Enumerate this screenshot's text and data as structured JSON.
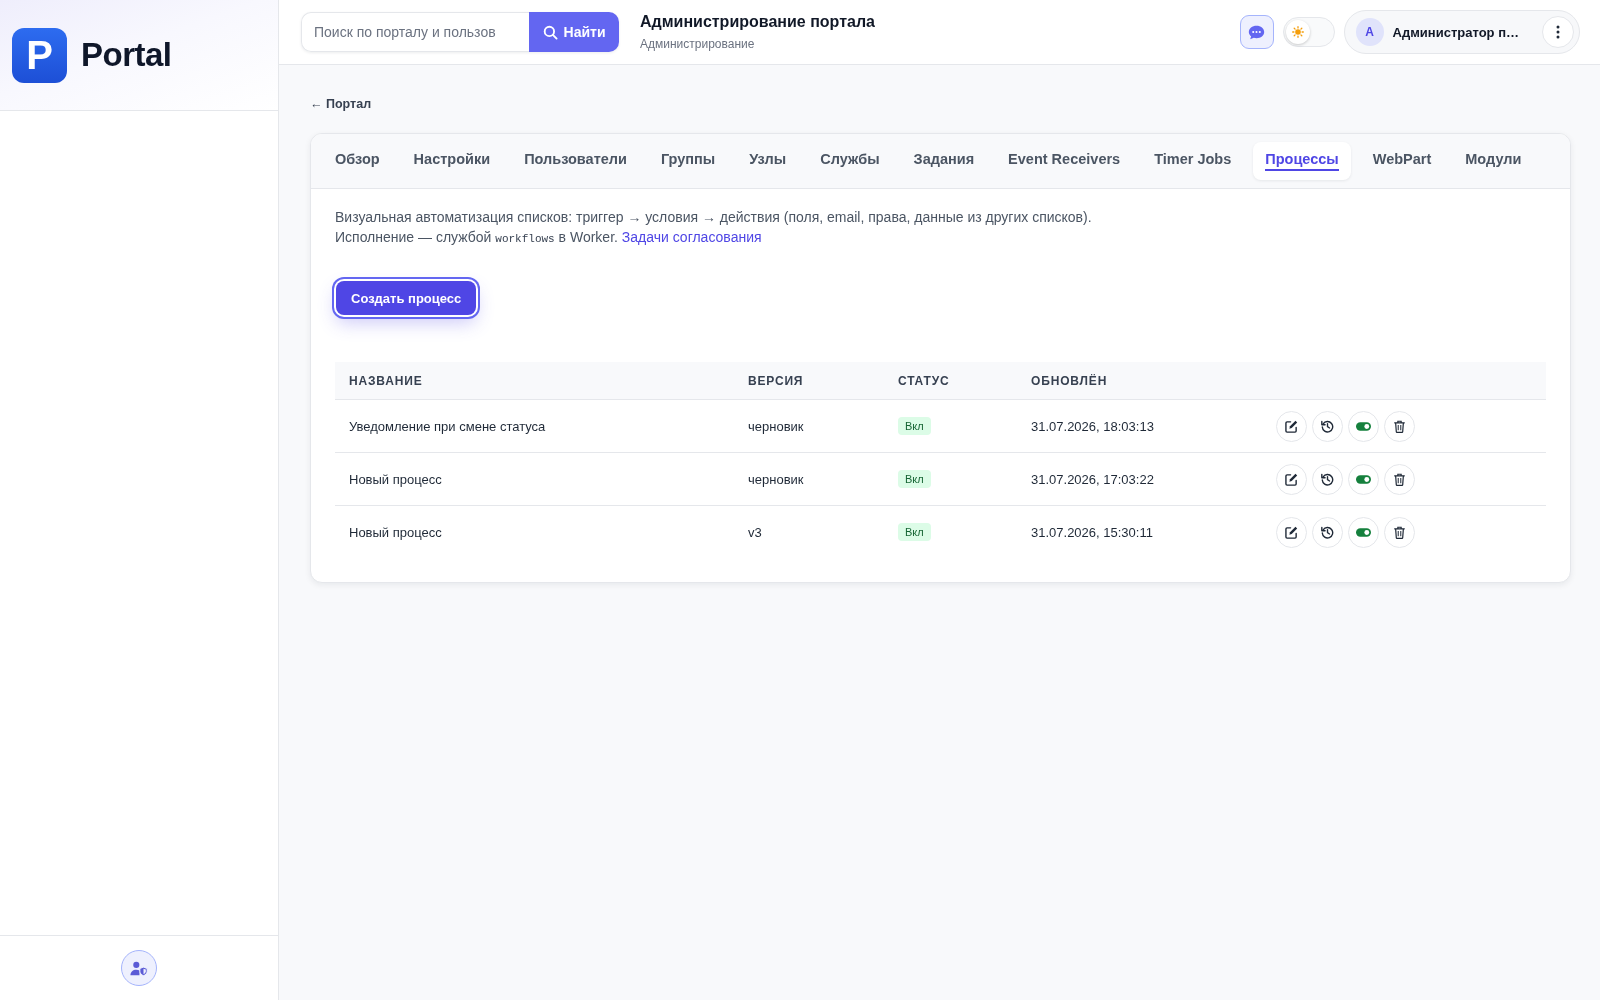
{
  "sidebar": {
    "logo_letter": "P",
    "brand": "Portal"
  },
  "topbar": {
    "search": {
      "placeholder": "Поиск по порталу и пользов",
      "button": "Найти"
    },
    "title": "Администрирование портала",
    "subtitle": "Администрирование",
    "theme_toggle": {
      "on": false
    },
    "user": {
      "initial": "A",
      "name": "Администратор п…"
    }
  },
  "back_link": "← Портал",
  "tabs": [
    {
      "label": "Обзор",
      "selected": false
    },
    {
      "label": "Настройки",
      "selected": false
    },
    {
      "label": "Пользователи",
      "selected": false
    },
    {
      "label": "Группы",
      "selected": false
    },
    {
      "label": "Узлы",
      "selected": false
    },
    {
      "label": "Службы",
      "selected": false
    },
    {
      "label": "Задания",
      "selected": false
    },
    {
      "label": "Event Receivers",
      "selected": false
    },
    {
      "label": "Timer Jobs",
      "selected": false
    },
    {
      "label": "Процессы",
      "selected": true
    },
    {
      "label": "WebPart",
      "selected": false
    },
    {
      "label": "Модули",
      "selected": false
    }
  ],
  "description": {
    "line_1": "Визуальная автоматизация списков: триггер → условия → действия (поля, email, права, данные из других списков).",
    "line_2_before": "Исполнение — службой",
    "line_2_code": "workflows",
    "line_2_after": "в Worker.",
    "link": "Задачи согласования"
  },
  "create_button": "Создать процесс",
  "table": {
    "columns": [
      "НАЗВАНИЕ",
      "ВЕРСИЯ",
      "СТАТУС",
      "ОБНОВЛЁН"
    ],
    "rows": [
      {
        "name": "Уведомление при смене статуса",
        "version": "черновик",
        "status": "Вкл",
        "enabled": true,
        "updated": "31.07.2026, 18:03:13"
      },
      {
        "name": "Новый процесс",
        "version": "черновик",
        "status": "Вкл",
        "enabled": true,
        "updated": "31.07.2026, 17:03:22"
      },
      {
        "name": "Новый процесс",
        "version": "v3",
        "status": "Вкл",
        "enabled": true,
        "updated": "31.07.2026, 15:30:11"
      }
    ]
  }
}
